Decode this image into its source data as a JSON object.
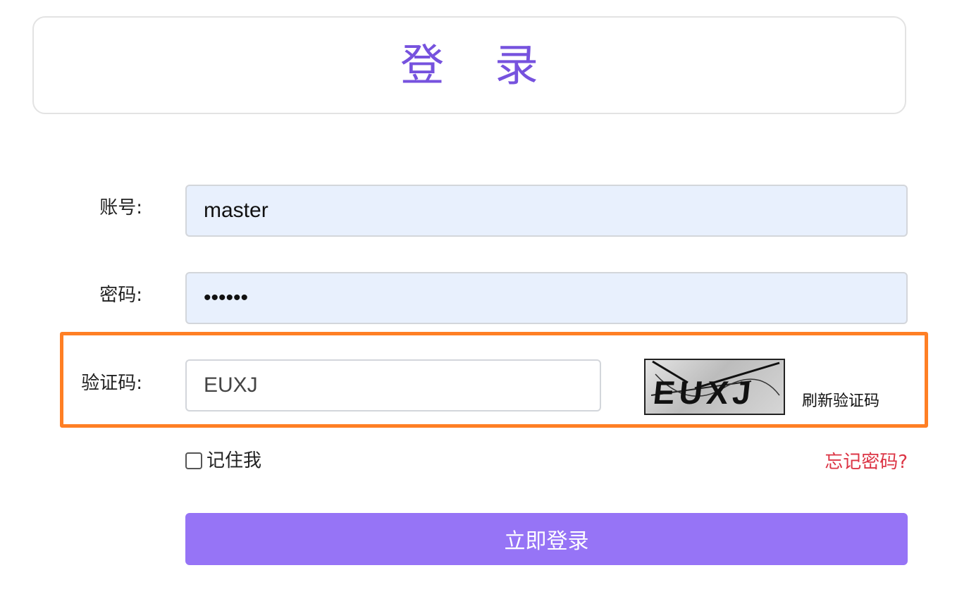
{
  "header": {
    "title": "登 录"
  },
  "form": {
    "account": {
      "label": "账号:",
      "value": "master"
    },
    "password": {
      "label": "密码:",
      "value": "••••••"
    },
    "captcha": {
      "label": "验证码:",
      "value": "EUXJ",
      "image_text": "EUXJ",
      "refresh_label": "刷新验证码"
    },
    "remember": {
      "label": "记住我",
      "checked": false
    },
    "forgot_label": "忘记密码?",
    "submit_label": "立即登录"
  },
  "colors": {
    "title": "#7652de",
    "input_filled_bg": "#e8f0fd",
    "highlight_border": "#ff7f24",
    "forgot_link": "#dc3545",
    "submit_bg": "#9674f6"
  },
  "icons": [
    "checkbox-icon"
  ]
}
